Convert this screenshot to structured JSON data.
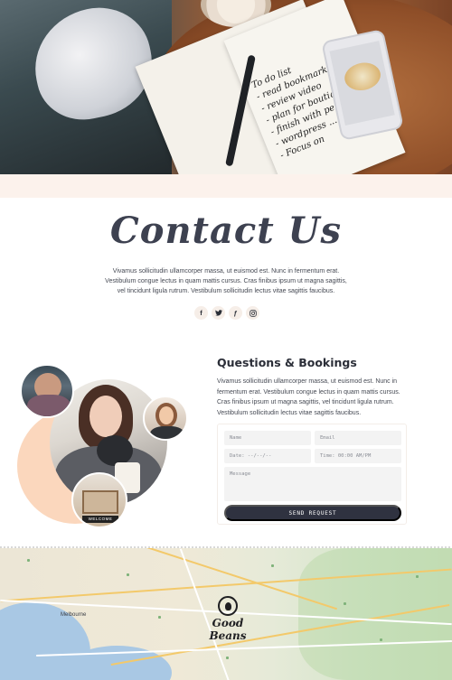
{
  "hero": {
    "notebook_lines": [
      "To do list",
      "- read bookmark",
      "- review video",
      "- plan for boutiq",
      "- finish with pe",
      "- wordpress ...",
      "- Focus on"
    ]
  },
  "contact": {
    "title": "Contact Us",
    "body": "Vivamus sollicitudin ullamcorper massa, ut euismod est. Nunc in fermentum erat. Vestibulum congue lectus in quam mattis cursus. Cras finibus ipsum ut magna sagittis, vel tincidunt ligula rutrum. Vestibulum sollicitudin lectus vitae sagittis faucibus.",
    "socials": [
      {
        "icon": "facebook-icon",
        "glyph": "f"
      },
      {
        "icon": "twitter-icon",
        "glyph": "t"
      },
      {
        "icon": "foursquare-icon",
        "glyph": "ƒ"
      },
      {
        "icon": "instagram-icon",
        "glyph": "◎"
      }
    ]
  },
  "collage": {
    "sign_text": "WELCOME"
  },
  "questions": {
    "title": "Questions & Bookings",
    "body": "Vivamus sollicitudin ullamcorper massa, ut euismod est. Nunc in fermentum erat. Vestibulum congue lectus in quam mattis cursus. Cras finibus ipsum ut magna sagittis, vel tincidunt ligula rutrum. Vestibulum sollicitudin lectus vitae sagittis faucibus."
  },
  "form": {
    "name_placeholder": "Name",
    "email_placeholder": "Email",
    "date_placeholder": "Date: --/--/--",
    "time_placeholder": "Time: 00:00 AM/PM",
    "message_placeholder": "Message",
    "submit_label": "SEND REQUEST"
  },
  "map": {
    "city_label": "Melbourne",
    "brand_name": "Good Beans"
  },
  "colors": {
    "accent_dark": "#2f3240",
    "peach": "#fbd7bd",
    "band": "#fcf2ec"
  }
}
